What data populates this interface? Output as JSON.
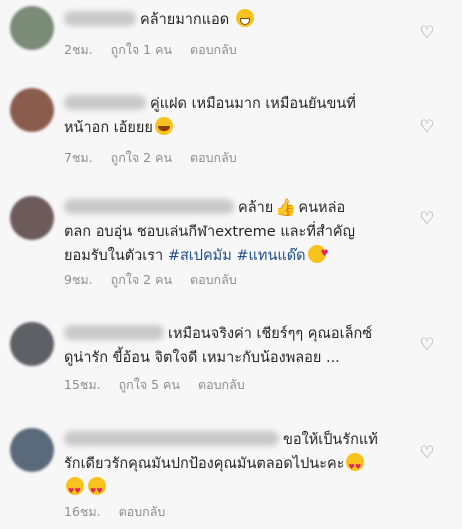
{
  "comments": [
    {
      "text": "คล้ายมากแอด",
      "time": "2ชม.",
      "likes": "ถูกใจ 1 คน",
      "reply": "ตอบกลับ",
      "emoji": "grin",
      "avatar_color": "#7a8b76"
    },
    {
      "text1": "คู่แฝด เหมือนมาก เหมือนยันขนที่",
      "text2": "หน้าอก เอ้ยยย",
      "time": "7ชม.",
      "likes": "ถูกใจ 2 คน",
      "reply": "ตอบกลับ",
      "emoji": "laugh",
      "avatar_color": "#8a5c4d"
    },
    {
      "text1a": "คล้าย",
      "text1b": "คนหล่อ",
      "text2": "ตลก อบอุ่น ชอบเล่นกีฬาextreme และที่สำคัญ",
      "text3": "ยอมรับในตัวเรา",
      "hashtags": "#สเปคมัม #แทนแด๊ด",
      "time": "9ชม.",
      "likes": "ถูกใจ 2 คน",
      "reply": "ตอบกลับ",
      "avatar_color": "#6d5a5a"
    },
    {
      "text1": "เหมือนจริงค่า เชียร์ๆๆ คุณอเล็กซ์",
      "text2": "ดูน่ารัก ขี้อ้อน จิตใจดี เหมาะกับน้องพลอย ...",
      "time": "15ชม.",
      "likes": "ถูกใจ 5 คน",
      "reply": "ตอบกลับ",
      "avatar_color": "#5f5f66"
    },
    {
      "text1": "ขอให้เป็นรักแท้",
      "text2": "รักเดียวรักคุณมันปกป้องคุณมันตลอดไปนะคะ",
      "time": "16ชม.",
      "reply": "ตอบกลับ",
      "avatar_color": "#5a6a7a"
    }
  ],
  "icons": {
    "like": "heart-outline-icon",
    "thumb": "thumbs-up-emoji",
    "emoji_colors": {
      "face": "#f8c21e",
      "heart": "#e0245e"
    }
  }
}
